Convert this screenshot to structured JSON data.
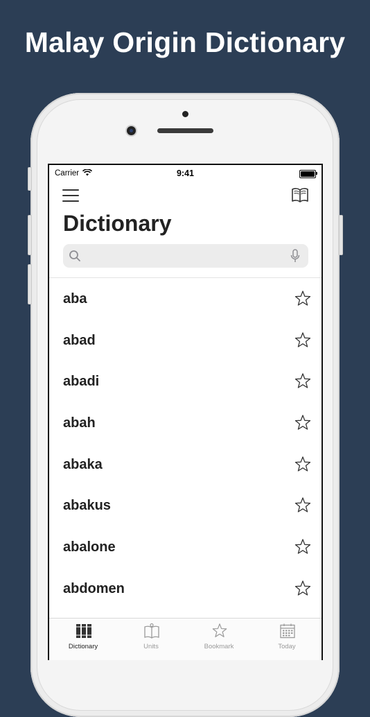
{
  "headline": "Malay Origin Dictionary",
  "status_bar": {
    "carrier": "Carrier",
    "time": "9:41"
  },
  "header": {
    "title": "Dictionary"
  },
  "search": {
    "placeholder": ""
  },
  "words": [
    {
      "word": "aba"
    },
    {
      "word": "abad"
    },
    {
      "word": "abadi"
    },
    {
      "word": "abah"
    },
    {
      "word": "abaka"
    },
    {
      "word": "abakus"
    },
    {
      "word": "abalone"
    },
    {
      "word": "abdomen"
    }
  ],
  "tabs": [
    {
      "label": "Dictionary",
      "icon": "books-icon",
      "active": true
    },
    {
      "label": "Units",
      "icon": "open-book-icon",
      "active": false
    },
    {
      "label": "Bookmark",
      "icon": "star-icon",
      "active": false
    },
    {
      "label": "Today",
      "icon": "calendar-icon",
      "active": false
    }
  ],
  "colors": {
    "background": "#2c3e55",
    "text": "#222222",
    "inactive_tab": "#9a9a9a"
  }
}
